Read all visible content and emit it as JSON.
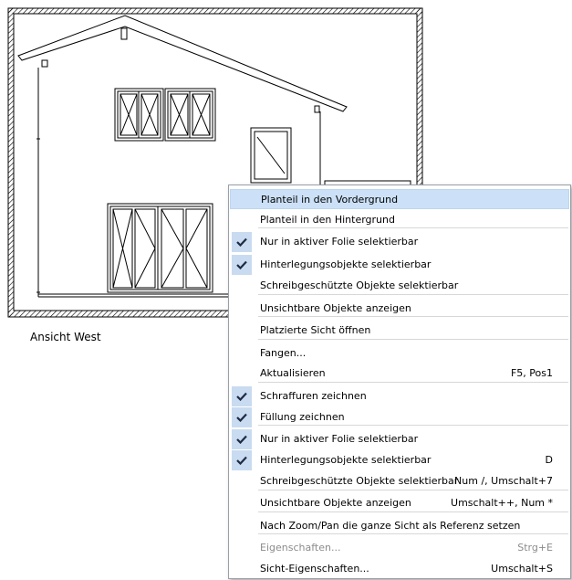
{
  "view_caption": "Ansicht West",
  "context_menu": {
    "items": [
      {
        "label": "Planteil in den Vordergrund",
        "shortcut": "",
        "checked": false,
        "disabled": false,
        "highlighted": true
      },
      {
        "label": "Planteil in den Hintergrund",
        "shortcut": "",
        "checked": false,
        "disabled": false,
        "highlighted": false
      },
      {
        "label": "Nur in aktiver Folie selektierbar",
        "shortcut": "",
        "checked": true,
        "disabled": false,
        "highlighted": false
      },
      {
        "label": "Hinterlegungsobjekte selektierbar",
        "shortcut": "",
        "checked": true,
        "disabled": false,
        "highlighted": false
      },
      {
        "label": "Schreibgeschützte Objekte selektierbar",
        "shortcut": "",
        "checked": false,
        "disabled": false,
        "highlighted": false
      },
      {
        "label": "Unsichtbare Objekte anzeigen",
        "shortcut": "",
        "checked": false,
        "disabled": false,
        "highlighted": false
      },
      {
        "label": "Platzierte Sicht öffnen",
        "shortcut": "",
        "checked": false,
        "disabled": false,
        "highlighted": false
      },
      {
        "label": "Fangen...",
        "shortcut": "",
        "checked": false,
        "disabled": false,
        "highlighted": false
      },
      {
        "label": "Aktualisieren",
        "shortcut": "F5, Pos1",
        "checked": false,
        "disabled": false,
        "highlighted": false
      },
      {
        "label": "Schraffuren zeichnen",
        "shortcut": "",
        "checked": true,
        "disabled": false,
        "highlighted": false
      },
      {
        "label": "Füllung zeichnen",
        "shortcut": "",
        "checked": true,
        "disabled": false,
        "highlighted": false
      },
      {
        "label": "Nur in aktiver Folie selektierbar",
        "shortcut": "",
        "checked": true,
        "disabled": false,
        "highlighted": false
      },
      {
        "label": "Hinterlegungsobjekte selektierbar",
        "shortcut": "D",
        "checked": true,
        "disabled": false,
        "highlighted": false
      },
      {
        "label": "Schreibgeschützte Objekte selektierbar",
        "shortcut": "Num /, Umschalt+7",
        "checked": false,
        "disabled": false,
        "highlighted": false
      },
      {
        "label": "Unsichtbare Objekte anzeigen",
        "shortcut": "Umschalt++, Num *",
        "checked": false,
        "disabled": false,
        "highlighted": false
      },
      {
        "label": "Nach Zoom/Pan die ganze Sicht als Referenz setzen",
        "shortcut": "",
        "checked": false,
        "disabled": false,
        "highlighted": false
      },
      {
        "label": "Eigenschaften...",
        "shortcut": "Strg+E",
        "checked": false,
        "disabled": true,
        "highlighted": false
      },
      {
        "label": "Sicht-Eigenschaften...",
        "shortcut": "Umschalt+S",
        "checked": false,
        "disabled": false,
        "highlighted": false
      }
    ]
  }
}
